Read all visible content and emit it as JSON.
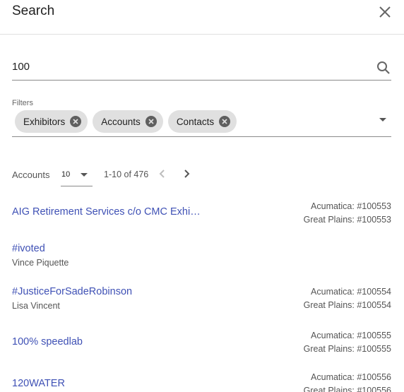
{
  "header": {
    "title": "Search"
  },
  "search": {
    "value": "100"
  },
  "filters": {
    "label": "Filters",
    "chips": [
      "Exhibitors",
      "Accounts",
      "Contacts"
    ]
  },
  "pager": {
    "label": "Accounts",
    "page_size": "10",
    "range": "1-10 of 476"
  },
  "results": [
    {
      "name": "AIG Retirement Services c/o CMC Exhi…",
      "contact": "",
      "ids": [
        "Acumatica: #100553",
        "Great Plains: #100553"
      ]
    },
    {
      "name": "#ivoted",
      "contact": "Vince Piquette",
      "ids": []
    },
    {
      "name": "#JusticeForSadeRobinson",
      "contact": "Lisa Vincent",
      "ids": [
        "Acumatica: #100554",
        "Great Plains: #100554"
      ]
    },
    {
      "name": "100% speedlab",
      "contact": "",
      "ids": [
        "Acumatica: #100555",
        "Great Plains: #100555"
      ]
    },
    {
      "name": "120WATER",
      "contact": "",
      "ids": [
        "Acumatica: #100556",
        "Great Plains: #100556"
      ]
    }
  ],
  "colors": {
    "link": "#3f51b5",
    "chip_bg": "#e0e0e0",
    "divider": "#e0e0e0"
  }
}
